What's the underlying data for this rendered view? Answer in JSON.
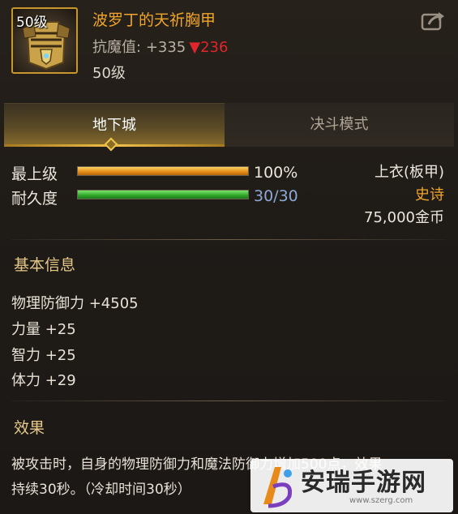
{
  "item": {
    "level_badge": "50级",
    "name": "波罗丁的天祈胸甲",
    "anti_magic_label": "抗魔值:",
    "anti_magic_value": "+335",
    "anti_magic_delta": "▼236",
    "required_level": "50级",
    "icon": "chest-armor-icon"
  },
  "tabs": [
    {
      "label": "地下城",
      "active": true
    },
    {
      "label": "决斗模式",
      "active": false
    }
  ],
  "stats": {
    "upgrade_label": "最上级",
    "upgrade_value": "100%",
    "upgrade_fraction": 1.0,
    "durability_label": "耐久度",
    "durability_value": "30/30",
    "durability_fraction": 1.0
  },
  "side": {
    "slot": "上衣(板甲)",
    "rarity": "史诗",
    "price": "75,000金币"
  },
  "basic_info": {
    "title": "基本信息",
    "attributes": [
      "物理防御力 +4505",
      "力量 +25",
      "智力 +25",
      "体力 +29"
    ]
  },
  "effect": {
    "title": "效果",
    "line1": "被攻击时，自身的物理防御力和魔法防御力增加500点，效果",
    "line2": "持续30秒。（冷却时间30秒）"
  },
  "watermark": {
    "title": "安瑞手游网",
    "url": "www.szerg.com"
  },
  "colors": {
    "item_name": "#f0a52a",
    "rarity": "#f0a52a",
    "delta_down": "#e0262a",
    "durability_value": "#8ea9d6",
    "accent_gold": "#f2c04a"
  }
}
